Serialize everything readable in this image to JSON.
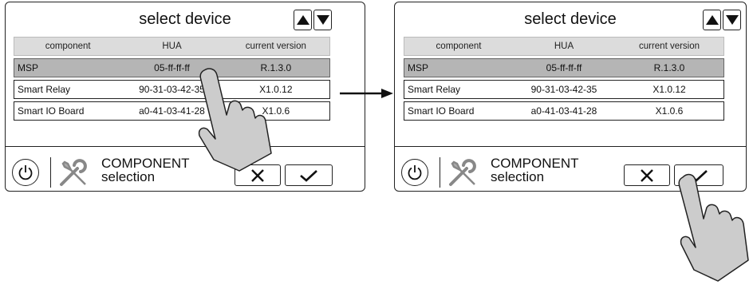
{
  "screens": [
    {
      "id": "before",
      "title": "select device",
      "columns": [
        "component",
        "HUA",
        "current version"
      ],
      "rows": [
        {
          "component": "MSP",
          "hua": "05-ff-ff-ff",
          "version": "R.1.3.0",
          "selected": true
        },
        {
          "component": "Smart Relay",
          "hua": "90-31-03-42-35",
          "version": "X1.0.12",
          "selected": false
        },
        {
          "component": "Smart IO Board",
          "hua": "a0-41-03-41-28",
          "version": "X1.0.6",
          "selected": false
        }
      ],
      "footer": {
        "line1": "COMPONENT",
        "line2": "selection"
      }
    },
    {
      "id": "after",
      "title": "select device",
      "columns": [
        "component",
        "HUA",
        "current version"
      ],
      "rows": [
        {
          "component": "MSP",
          "hua": "05-ff-ff-ff",
          "version": "R.1.3.0",
          "selected": true
        },
        {
          "component": "Smart Relay",
          "hua": "90-31-03-42-35",
          "version": "X1.0.12",
          "selected": false
        },
        {
          "component": "Smart IO Board",
          "hua": "a0-41-03-41-28",
          "version": "X1.0.6",
          "selected": false
        }
      ],
      "footer": {
        "line1": "COMPONENT",
        "line2": "selection"
      }
    }
  ],
  "icons": {
    "scroll_up": "triangle-up-icon",
    "scroll_down": "triangle-down-icon",
    "power": "power-icon",
    "tools": "wrench-screwdriver-icon",
    "cancel": "x-icon",
    "confirm": "checkmark-icon",
    "pointer": "pointing-hand-icon",
    "transition": "right-arrow-icon"
  },
  "colors": {
    "selected_row": "#b5b5b5",
    "header_row": "#dcdcdc",
    "hand_fill": "#cccccc",
    "outline": "#222222"
  }
}
